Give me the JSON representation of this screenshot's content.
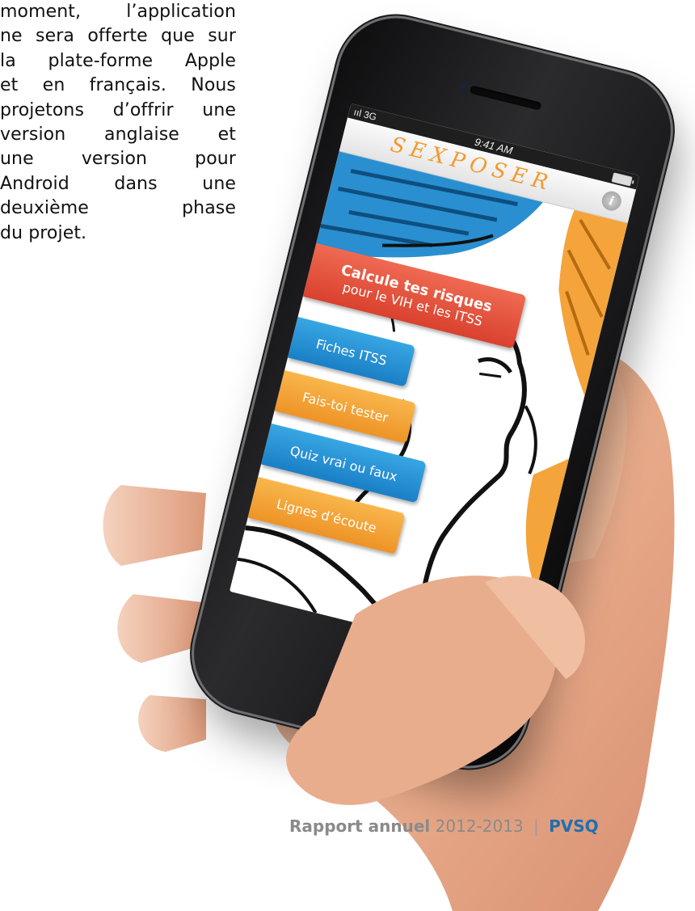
{
  "article": {
    "lines": [
      "moment,      l’application",
      "ne sera offerte que sur",
      "la  plate-forme  Apple",
      "et  en  français.  Nous",
      "projetons d’offrir une",
      "version  anglaise  et",
      "une   version   pour",
      "Android  dans  une",
      "deuxième      phase",
      "du projet."
    ]
  },
  "phone": {
    "status": {
      "signal": "3G",
      "time": "9:41 AM"
    },
    "app": {
      "logo": "SEXPOSER",
      "info_icon": "info-icon",
      "menu": {
        "primary": {
          "title": "Calcule tes risques",
          "subtitle": "pour le VIH et les ITSS"
        },
        "items": [
          {
            "label": "Fiches ITSS",
            "color": "#2b93d6"
          },
          {
            "label": "Fais-toi tester",
            "color": "#f4a43a"
          },
          {
            "label": "Quiz vrai ou faux",
            "color": "#2b93d6"
          },
          {
            "label": "Lignes d’écoute",
            "color": "#f4a43a"
          }
        ]
      }
    }
  },
  "footer": {
    "title": "Rapport annuel",
    "years": "2012-2013",
    "separator": "|",
    "org": "PVSQ"
  },
  "colors": {
    "accent_blue": "#2b93d6",
    "accent_orange": "#f4a43a",
    "accent_red": "#e2533e",
    "org_blue": "#1f6fb0"
  }
}
